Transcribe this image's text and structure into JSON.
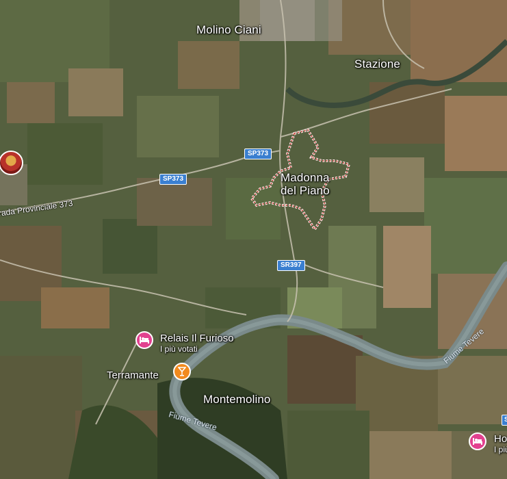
{
  "places": {
    "molino_ciani": "Molino Ciani",
    "stazione": "Stazione",
    "madonna_line1": "Madonna",
    "madonna_line2": "del Piano",
    "montemolino": "Montemolino"
  },
  "roads": {
    "sp373_a": "SP373",
    "sp373_b": "SP373",
    "sr397": "SR397",
    "provinciale": "rada Provinciale 373"
  },
  "rivers": {
    "tevere_1": "Fiume Tevere",
    "tevere_2": "Fiume Tevere"
  },
  "pois": {
    "relais_name": "Relais Il Furioso",
    "relais_sub": "I più votati",
    "terramante_name": "Terramante",
    "edge_name": "Ho",
    "edge_sub": "I più"
  },
  "colors": {
    "hotel": "#e2418f",
    "bar": "#f28a1e",
    "shield": "#3a7fd0",
    "boundary": "#f2dada"
  },
  "icons": {
    "hotel": "bed-icon",
    "bar": "cocktail-icon",
    "photo": "place-photo-icon"
  }
}
